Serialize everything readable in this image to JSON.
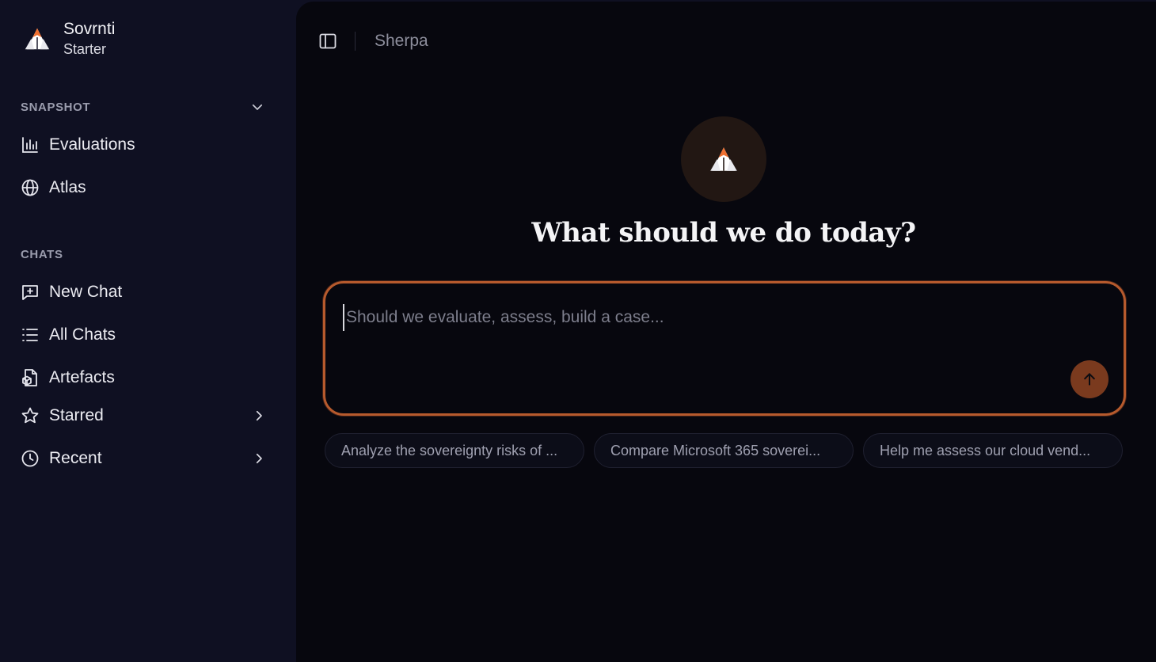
{
  "brand": {
    "name": "Sovrnti",
    "plan": "Starter"
  },
  "sidebar": {
    "snapshot_label": "SNAPSHOT",
    "snapshot_items": [
      {
        "label": "Evaluations",
        "icon": "bar-chart-icon"
      },
      {
        "label": "Atlas",
        "icon": "globe-icon"
      }
    ],
    "chats_label": "CHATS",
    "chat_items": [
      {
        "label": "New Chat",
        "icon": "new-chat-icon"
      },
      {
        "label": "All Chats",
        "icon": "list-icon"
      },
      {
        "label": "Artefacts",
        "icon": "file-icon"
      },
      {
        "label": "Starred",
        "icon": "star-icon"
      },
      {
        "label": "Recent",
        "icon": "clock-icon"
      }
    ]
  },
  "header": {
    "breadcrumb": "Sherpa"
  },
  "main": {
    "title": "What should we do today?",
    "prompt_placeholder": "Should we evaluate, assess, build a case...",
    "suggestions": [
      "Analyze the sovereignty risks of ...",
      "Compare Microsoft 365 soverei...",
      "Help me assess our cloud vend..."
    ]
  },
  "colors": {
    "accent": "#b65a2d",
    "logo_orange": "#f07030",
    "sidebar_bg": "#0f1022",
    "main_bg": "#07070e"
  }
}
